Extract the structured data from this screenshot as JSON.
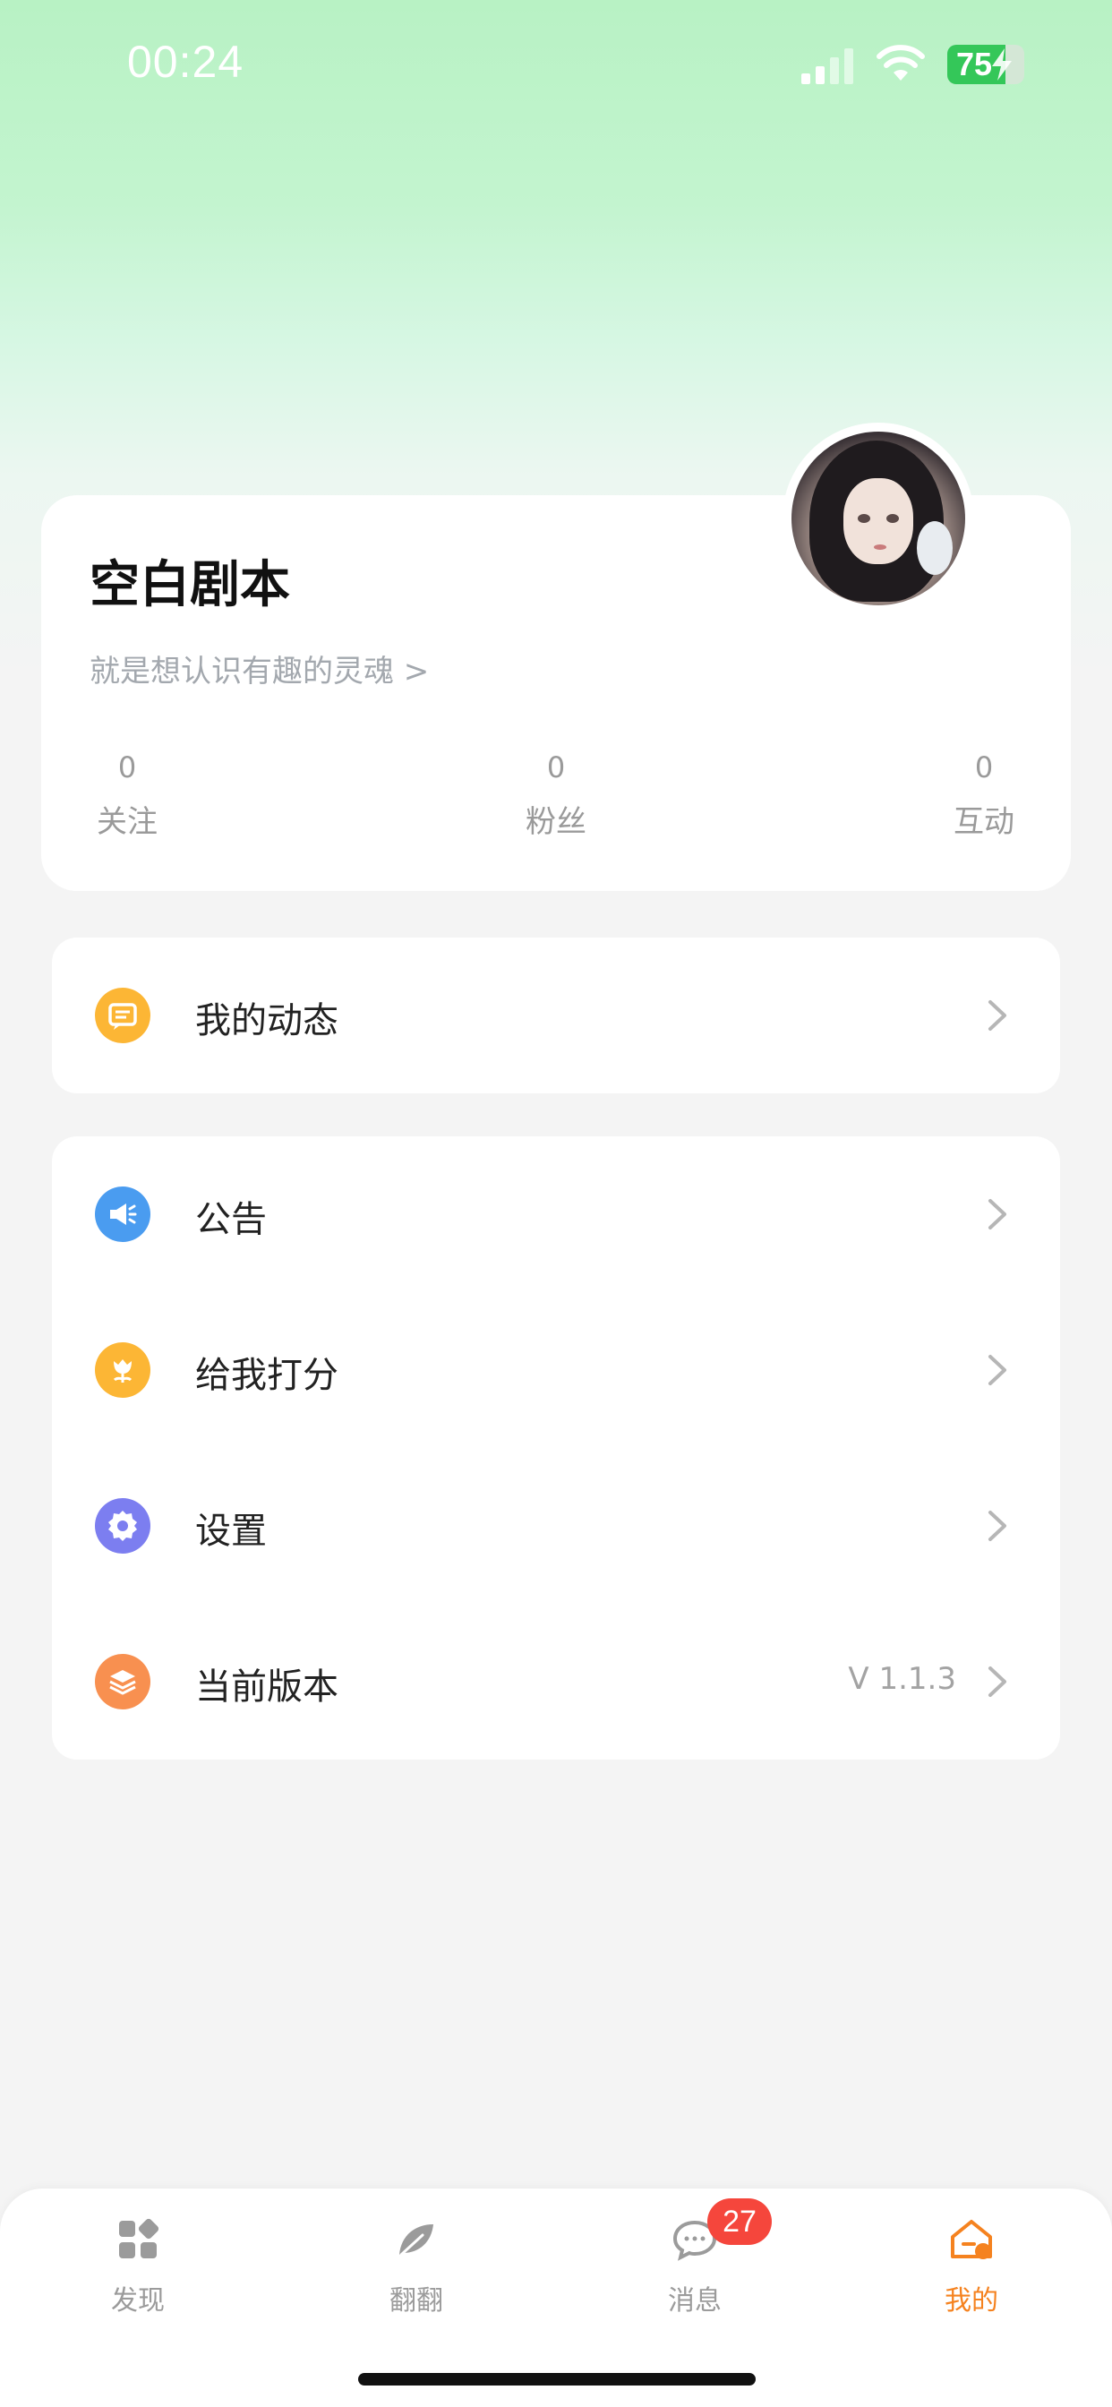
{
  "status_bar": {
    "time": "00:24",
    "battery": "75",
    "battery_level": 0.75,
    "icons": [
      "signal-icon",
      "wifi-icon",
      "battery-icon",
      "charging-bolt-icon"
    ]
  },
  "profile": {
    "name": "空白剧本",
    "bio": "就是想认识有趣的灵魂 >",
    "stats": [
      {
        "value": "0",
        "label": "关注"
      },
      {
        "value": "0",
        "label": "粉丝"
      },
      {
        "value": "0",
        "label": "互动"
      }
    ]
  },
  "menu_primary": [
    {
      "label": "我的动态",
      "icon": "chat-bubble-icon",
      "color": "#fcb635"
    }
  ],
  "menu_secondary": [
    {
      "label": "公告",
      "icon": "megaphone-icon",
      "color": "#4a9cf0"
    },
    {
      "label": "给我打分",
      "icon": "flower-icon",
      "color": "#fcb635"
    },
    {
      "label": "设置",
      "icon": "gear-icon",
      "color": "#7c7ef0"
    },
    {
      "label": "当前版本",
      "icon": "layers-icon",
      "color": "#f89050",
      "value": "V 1.1.3"
    }
  ],
  "tabs": [
    {
      "label": "发现",
      "icon": "grid-icon",
      "active": false
    },
    {
      "label": "翻翻",
      "icon": "leaf-icon",
      "active": false
    },
    {
      "label": "消息",
      "icon": "message-icon",
      "active": false,
      "badge": "27"
    },
    {
      "label": "我的",
      "icon": "home-icon",
      "active": true
    }
  ],
  "colors": {
    "accent": "#f5821f",
    "badge": "#f5463c",
    "header_green": "#b8f2c4",
    "battery_green": "#34c759"
  }
}
